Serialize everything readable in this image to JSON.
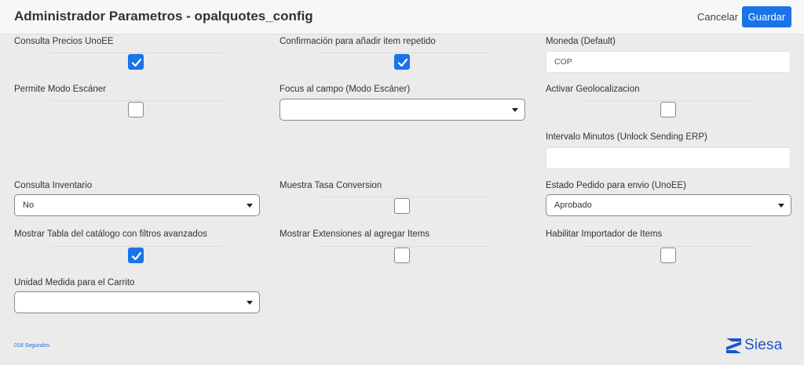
{
  "header": {
    "title": "Administrador Parametros - opalquotes_config",
    "cancel_label": "Cancelar",
    "save_label": "Guardar"
  },
  "fields": {
    "consulta_precios": {
      "label": "Consulta Precios UnoEE",
      "checked": true
    },
    "confirmacion_item": {
      "label": "Confirmación para añadir item repetido",
      "checked": true
    },
    "moneda": {
      "label": "Moneda (Default)",
      "value": "COP"
    },
    "modo_escaner": {
      "label": "Permite Modo Escáner",
      "checked": false
    },
    "focus_campo": {
      "label": "Focus al campo (Modo Escáner)",
      "value": ""
    },
    "geolocalizacion": {
      "label": "Activar Geolocalizacion",
      "checked": false
    },
    "intervalo_minutos": {
      "label": "Intervalo Minutos (Unlock Sending ERP)",
      "value": ""
    },
    "consulta_inventario": {
      "label": "Consulta Inventario",
      "value": "No"
    },
    "tasa_conversion": {
      "label": "Muestra Tasa Conversion",
      "checked": false
    },
    "estado_pedido": {
      "label": "Estado Pedido para envio (UnoEE)",
      "value": "Aprobado"
    },
    "tabla_catalogo": {
      "label": "Mostrar Tabla del catálogo con filtros avanzados",
      "checked": true
    },
    "extensiones_items": {
      "label": "Mostrar Extensiones al agregar Items",
      "checked": false
    },
    "importador_items": {
      "label": "Habilitar Importador de Items",
      "checked": false
    },
    "unidad_medida": {
      "label": "Unidad Medida para el Carrito",
      "value": ""
    }
  },
  "footer": {
    "load_time": "018 Segundos",
    "brand": "Siesa"
  },
  "colors": {
    "accent": "#1a73e8",
    "background": "#ebebeb",
    "brand": "#1a56c8"
  }
}
